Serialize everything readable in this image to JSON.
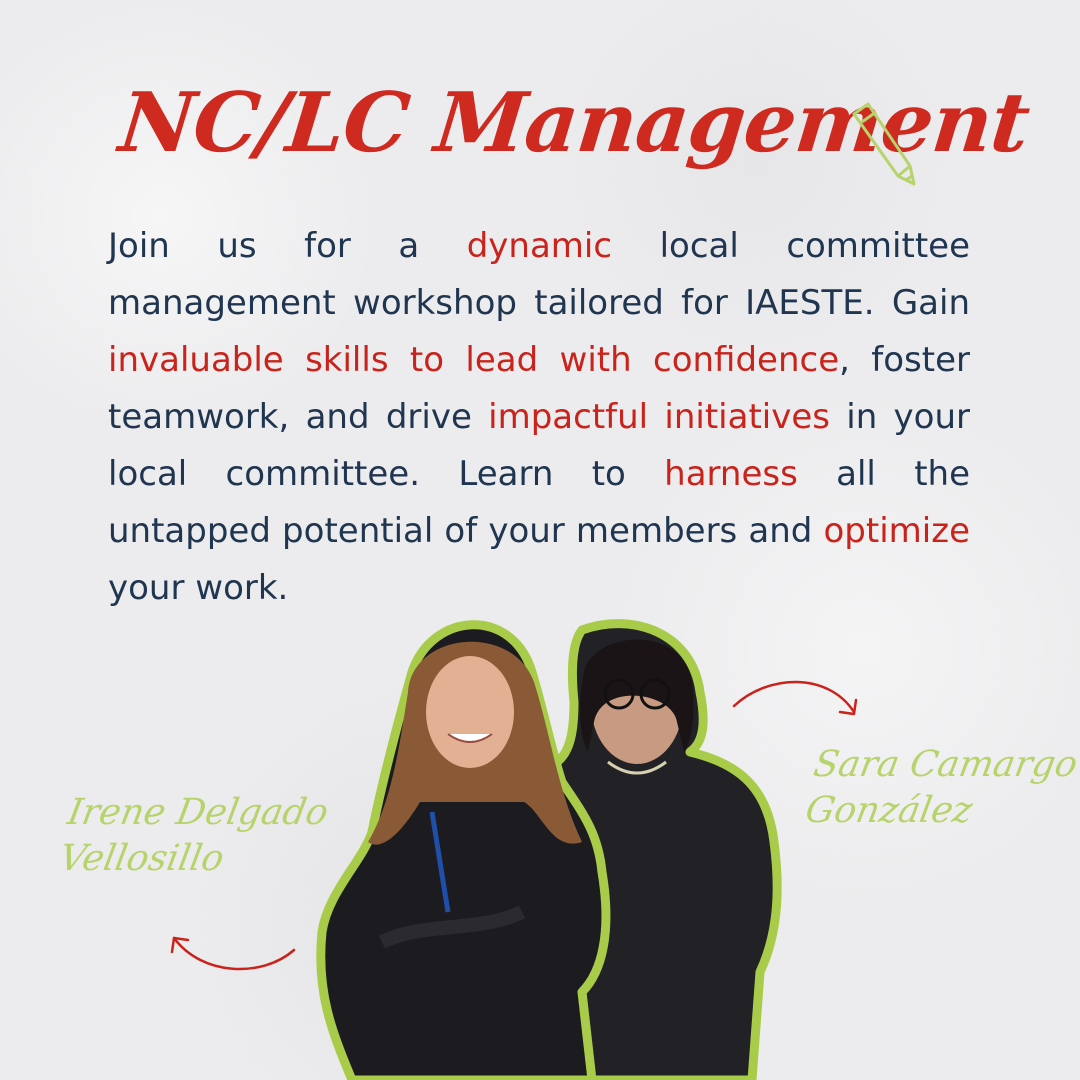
{
  "title": "NC/LC Management",
  "description": {
    "parts": [
      {
        "text": "Join us for a ",
        "highlight": false
      },
      {
        "text": "dynamic",
        "highlight": true
      },
      {
        "text": " local committee management workshop tailored for IAESTE. Gain ",
        "highlight": false
      },
      {
        "text": "invaluable skills to lead with confidence",
        "highlight": true
      },
      {
        "text": ", foster teamwork, and drive ",
        "highlight": false
      },
      {
        "text": "impactful initiatives",
        "highlight": true
      },
      {
        "text": " in your local committee. Learn to ",
        "highlight": false
      },
      {
        "text": "harness",
        "highlight": true
      },
      {
        "text": " all the untapped potential of your members and ",
        "highlight": false
      },
      {
        "text": "optimize",
        "highlight": true
      },
      {
        "text": " your work.",
        "highlight": false
      }
    ]
  },
  "speakers": [
    {
      "name_line1": "Irene Delgado",
      "name_line2": "Vellosillo"
    },
    {
      "name_line1": "Sara Camargo",
      "name_line2": "González"
    }
  ],
  "colors": {
    "title": "#cf2a20",
    "body_text": "#1f3550",
    "highlight": "#c9231c",
    "accent_green": "#b7d36b",
    "arrow": "#c9231c",
    "background": "#ecebed"
  },
  "icons": [
    "pencil-icon",
    "arrow-curved-right-icon",
    "arrow-curved-left-icon"
  ]
}
